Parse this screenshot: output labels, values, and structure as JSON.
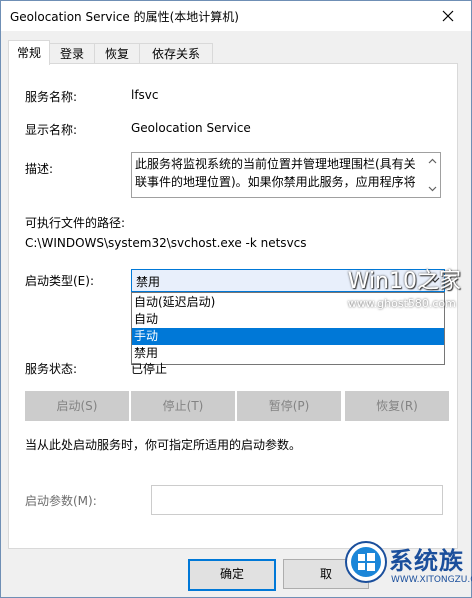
{
  "window": {
    "title": "Geolocation Service 的属性(本地计算机)"
  },
  "tabs": [
    {
      "label": "常规",
      "active": true
    },
    {
      "label": "登录",
      "active": false
    },
    {
      "label": "恢复",
      "active": false
    },
    {
      "label": "依存关系",
      "active": false
    }
  ],
  "general": {
    "service_name_label": "服务名称:",
    "service_name_value": "lfsvc",
    "display_name_label": "显示名称:",
    "display_name_value": "Geolocation Service",
    "description_label": "描述:",
    "description_value": "此服务将监视系统的当前位置并管理地理围栏(具有关联事件的地理位置)。如果你禁用此服务，应用程序将",
    "exe_path_label": "可执行文件的路径:",
    "exe_path_value": "C:\\WINDOWS\\system32\\svchost.exe -k netsvcs",
    "startup_type_label": "启动类型(E):",
    "startup_type_value": "禁用",
    "startup_options": [
      "自动(延迟启动)",
      "自动",
      "手动",
      "禁用"
    ],
    "startup_option_highlighted": "手动",
    "service_status_label": "服务状态:",
    "service_status_value": "已停止",
    "buttons": {
      "start": "启动(S)",
      "stop": "停止(T)",
      "pause": "暂停(P)",
      "resume": "恢复(R)"
    },
    "hint_text": "当从此处启动服务时，你可指定所适用的启动参数。",
    "start_params_label": "启动参数(M):",
    "start_params_value": ""
  },
  "footer": {
    "ok_label": "确定",
    "cancel_label": "取"
  },
  "watermark": {
    "brand": "Win10之家",
    "url": "www.ghost580.com"
  },
  "logo": {
    "text": "系统族",
    "sub": "WWW.XITONGZU.COM"
  },
  "colors": {
    "accent": "#0078d7",
    "selected_text": "#ffffff",
    "disabled_text": "#838383"
  }
}
